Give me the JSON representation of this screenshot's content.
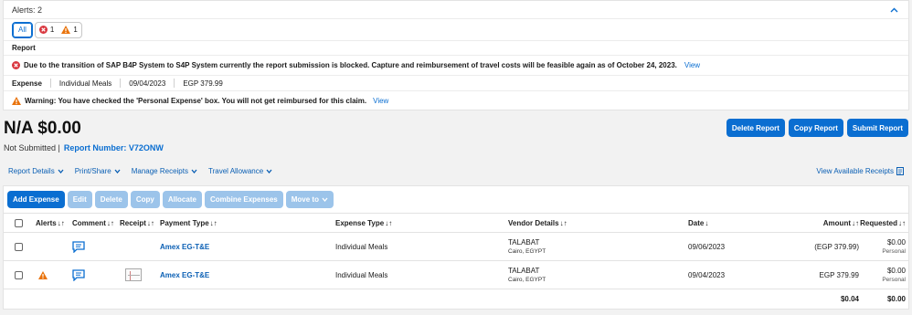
{
  "alerts": {
    "header": "Alerts: 2",
    "filter_all": "All",
    "error_count": "1",
    "warning_count": "1",
    "report_label": "Report",
    "error_message": "Due to the transition of SAP B4P System to S4P System currently the report submission is blocked. Capture and reimbursement of travel costs will be feasible again as of October 24, 2023.",
    "error_link": "View",
    "expense_label": "Expense",
    "expense_type": "Individual Meals",
    "expense_date": "09/04/2023",
    "expense_amount": "EGP 379.99",
    "warning_message": "Warning: You have checked the 'Personal Expense' box. You will not get reimbursed for this claim.",
    "warning_link": "View"
  },
  "report": {
    "title": "N/A $0.00",
    "status": "Not Submitted |",
    "number_label": "Report Number: V72ONW",
    "buttons": {
      "delete": "Delete Report",
      "copy": "Copy Report",
      "submit": "Submit Report"
    }
  },
  "menu": {
    "report_details": "Report Details",
    "print_share": "Print/Share",
    "manage_receipts": "Manage Receipts",
    "travel_allowance": "Travel Allowance",
    "view_receipts": "View Available Receipts"
  },
  "toolbar": {
    "add_expense": "Add Expense",
    "edit": "Edit",
    "delete": "Delete",
    "copy": "Copy",
    "allocate": "Allocate",
    "combine": "Combine Expenses",
    "move_to": "Move to"
  },
  "table": {
    "columns": {
      "alerts": "Alerts",
      "comment": "Comment",
      "receipt": "Receipt",
      "payment_type": "Payment Type",
      "expense_type": "Expense Type",
      "vendor": "Vendor Details",
      "date": "Date",
      "amount": "Amount",
      "requested": "Requested"
    },
    "rows": [
      {
        "payment_type": "Amex EG-T&E",
        "expense_type": "Individual Meals",
        "vendor": "TALABAT",
        "vendor_loc": "Cairo, EGYPT",
        "date": "09/06/2023",
        "amount": "(EGP 379.99)",
        "requested": "$0.00",
        "requested_sub": "Personal"
      },
      {
        "payment_type": "Amex EG-T&E",
        "expense_type": "Individual Meals",
        "vendor": "TALABAT",
        "vendor_loc": "Cairo, EGYPT",
        "date": "09/04/2023",
        "amount": "EGP 379.99",
        "requested": "$0.00",
        "requested_sub": "Personal"
      }
    ],
    "totals": {
      "amount": "$0.04",
      "requested": "$0.00"
    }
  },
  "colors": {
    "accent": "#0a6ed1",
    "disabled": "#9cc4ea",
    "error": "#d9363e",
    "warning": "#e9730c"
  },
  "icons": [
    "chevron-up-icon",
    "error-icon",
    "warning-icon",
    "chevron-down-icon",
    "receipts-icon",
    "comment-icon",
    "sort-icon",
    "receipt-thumbnail"
  ]
}
